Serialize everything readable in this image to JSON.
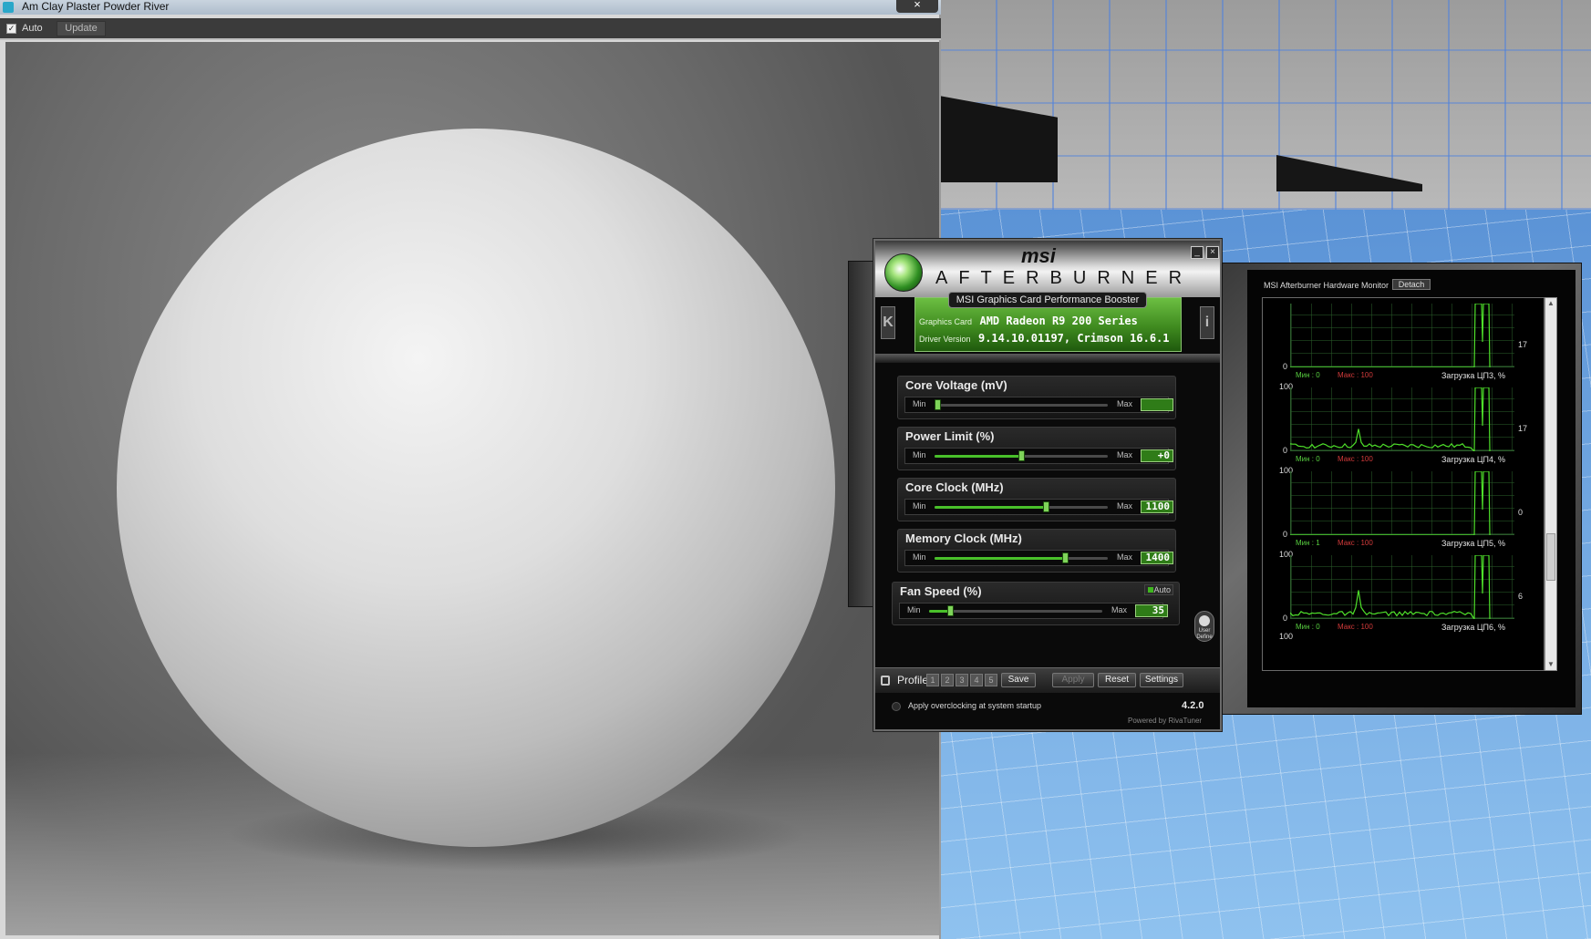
{
  "render_window": {
    "title": "Am Clay Plaster Powder River",
    "close_glyph": "×",
    "toolbar": {
      "auto_label": "Auto",
      "auto_checked": true,
      "update_label": "Update"
    }
  },
  "afterburner": {
    "brand": "msi",
    "product": "AFTERBURNER",
    "subtitle": "MSI Graphics Card Performance Booster",
    "graphics_card_label": "Graphics Card",
    "graphics_card_value": "AMD Radeon R9 200 Series",
    "driver_label": "Driver Version",
    "driver_value": "9.14.10.01197, Crimson 16.6.1",
    "min_label": "Min",
    "max_label": "Max",
    "sliders": [
      {
        "title": "Core Voltage (mV)",
        "value": "",
        "fraction": 0.0
      },
      {
        "title": "Power Limit (%)",
        "value": "+0",
        "fraction": 0.5
      },
      {
        "title": "Core Clock (MHz)",
        "value": "1100",
        "fraction": 0.64
      },
      {
        "title": "Memory Clock (MHz)",
        "value": "1400",
        "fraction": 0.75
      },
      {
        "title": "Fan Speed (%)",
        "value": "35",
        "fraction": 0.12
      }
    ],
    "fan_auto_label": "Auto",
    "user_define_label": "User Define",
    "profile_label": "Profile",
    "profile_slots": [
      "1",
      "2",
      "3",
      "4",
      "5"
    ],
    "save_label": "Save",
    "apply_label": "Apply",
    "reset_label": "Reset",
    "settings_label": "Settings",
    "startup_label": "Apply overclocking at system startup",
    "version": "4.2.0",
    "powered_by": "Powered by RivaTuner"
  },
  "hardware_monitor": {
    "title": "MSI Afterburner Hardware Monitor",
    "detach_label": "Detach",
    "graphs": [
      {
        "top": "",
        "zero": "0",
        "current": "17",
        "min_text": "Мин : 0",
        "max_text": "Макс : 100",
        "label": "Загрузка ЦП3, %",
        "spike": 0.0
      },
      {
        "top": "100",
        "zero": "0",
        "current": "17",
        "min_text": "Мин : 0",
        "max_text": "Макс : 100",
        "label": "Загрузка ЦП4, %",
        "spike": 0.35
      },
      {
        "top": "100",
        "zero": "0",
        "current": "0",
        "min_text": "Мин : 1",
        "max_text": "Макс : 100",
        "label": "Загрузка ЦП5, %",
        "spike": 0.0
      },
      {
        "top": "100",
        "zero": "0",
        "current": "6",
        "min_text": "Мин : 0",
        "max_text": "Макс : 100",
        "label": "Загрузка ЦП6, %",
        "spike": 0.45
      }
    ],
    "last_top": "100"
  }
}
